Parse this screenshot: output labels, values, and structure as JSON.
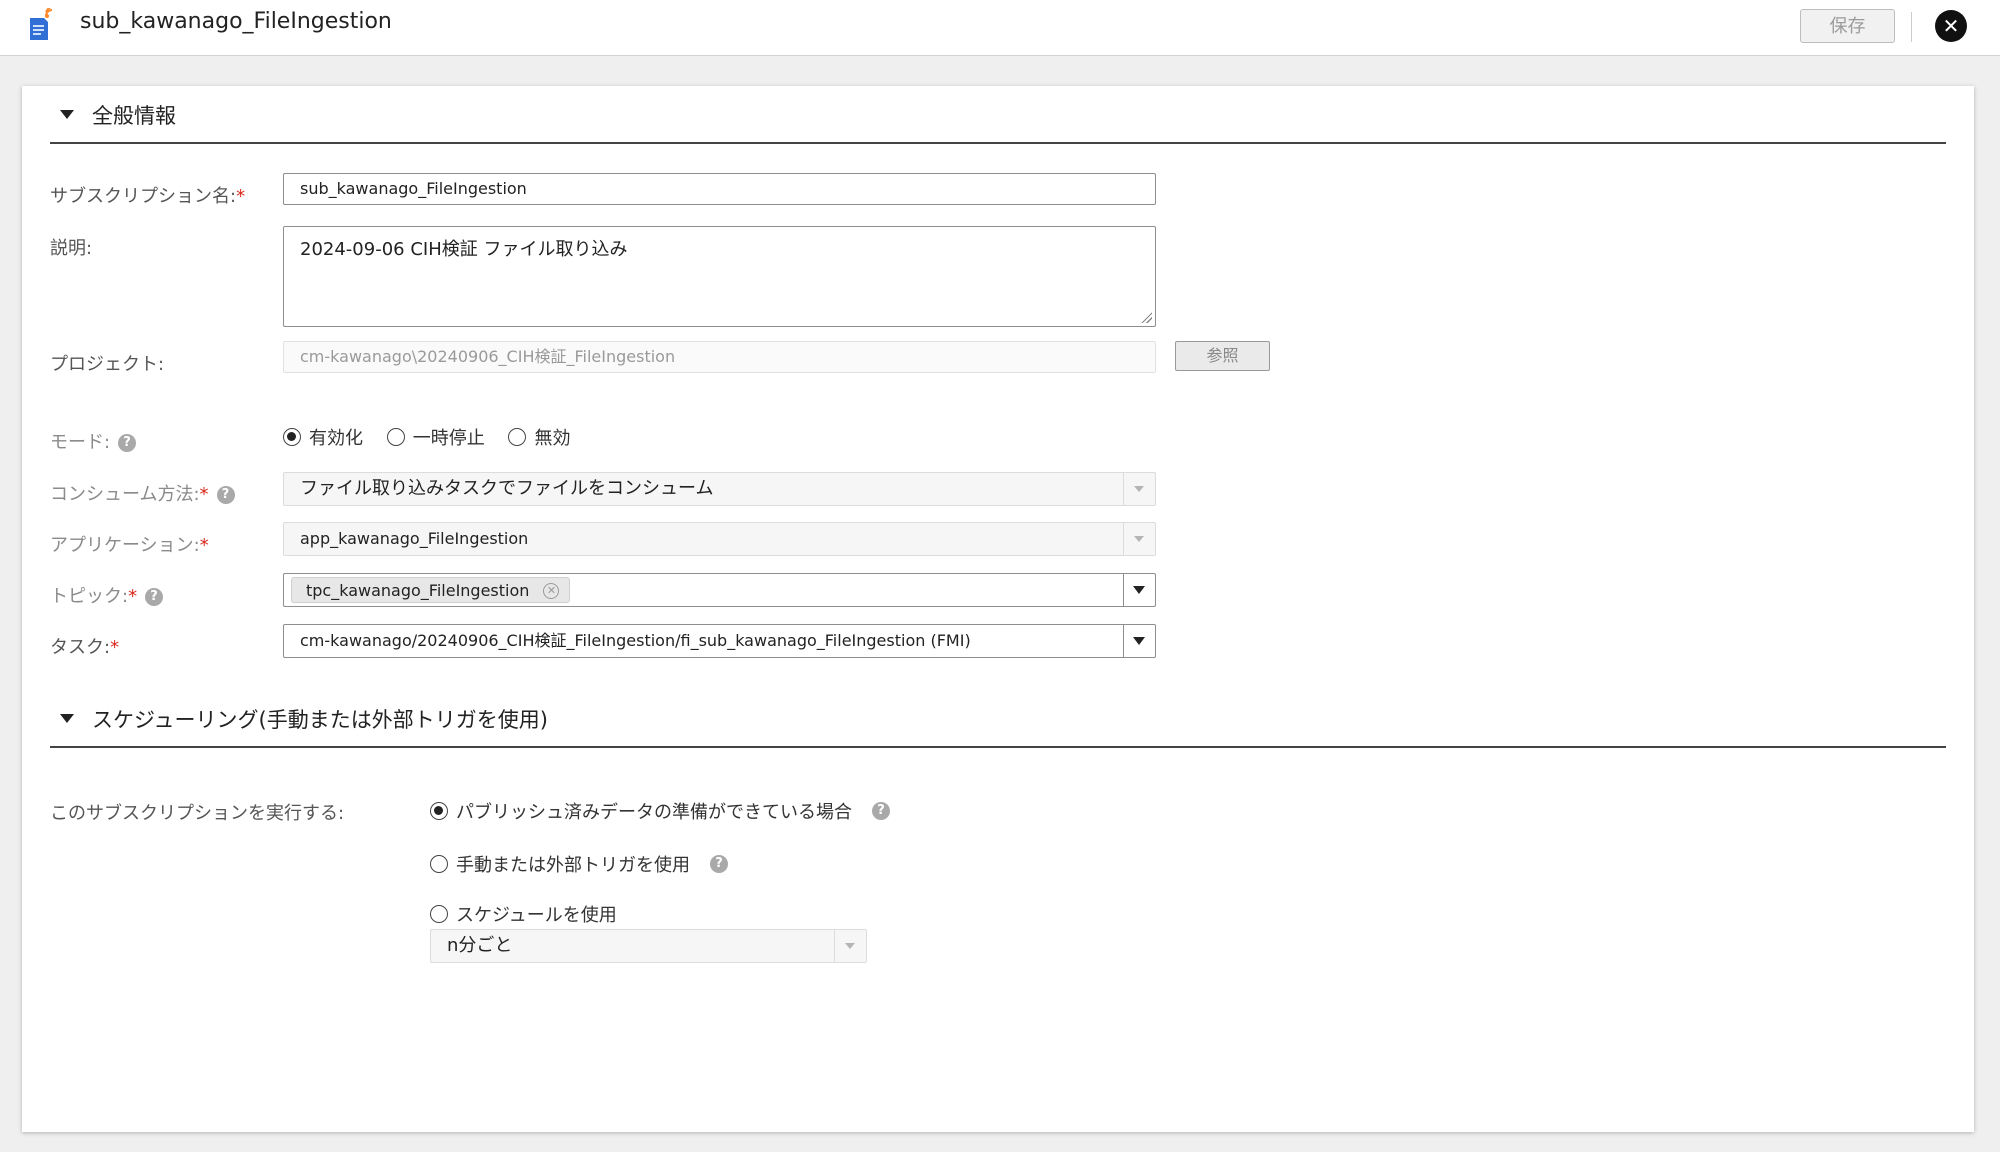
{
  "header": {
    "title": "sub_kawanago_FileIngestion",
    "app_icon": "document-broadcast-icon",
    "save_label": "保存",
    "close_icon": "close-icon"
  },
  "general": {
    "section_title": "全般情報",
    "subscription_name": {
      "label": "サブスクリプション名:",
      "required": "*",
      "value": "sub_kawanago_FileIngestion"
    },
    "description": {
      "label": "説明:",
      "value": "2024-09-06 CIH検証 ファイル取り込み"
    },
    "project": {
      "label": "プロジェクト:",
      "value": "cm-kawanago\\20240906_CIH検証_FileIngestion",
      "browse_label": "参照"
    },
    "mode": {
      "label": "モード:",
      "help_icon": "help-icon",
      "options": [
        "有効化",
        "一時停止",
        "無効"
      ],
      "selected": "有効化"
    },
    "consume_method": {
      "label": "コンシューム方法:",
      "required": "*",
      "value": "ファイル取り込みタスクでファイルをコンシューム"
    },
    "application": {
      "label": "アプリケーション:",
      "required": "*",
      "value": "app_kawanago_FileIngestion"
    },
    "topic": {
      "label": "トピック:",
      "required": "*",
      "tag": "tpc_kawanago_FileIngestion"
    },
    "task": {
      "label": "タスク:",
      "required": "*",
      "value": "cm-kawanago/20240906_CIH検証_FileIngestion/fi_sub_kawanago_FileIngestion (FMI)"
    }
  },
  "scheduling": {
    "section_title": "スケジューリング(手動または外部トリガを使用)",
    "run_label": "このサブスクリプションを実行する:",
    "options": [
      "パブリッシュ済みデータの準備ができている場合",
      "手動または外部トリガを使用",
      "スケジュールを使用"
    ],
    "selected": "パブリッシュ済みデータの準備ができている場合",
    "schedule_value": "n分ごと"
  }
}
